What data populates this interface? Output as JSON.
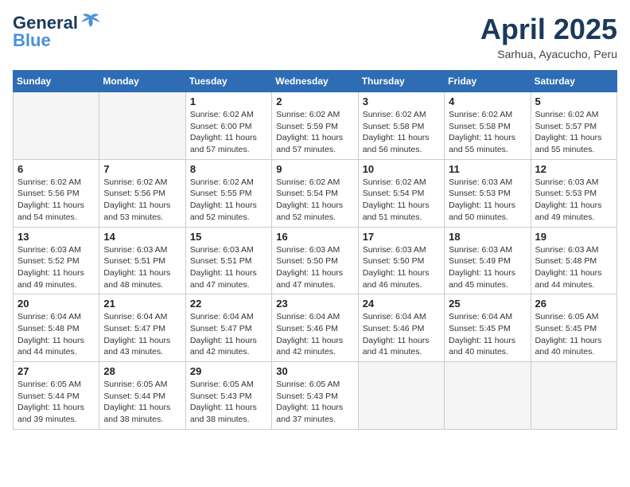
{
  "header": {
    "logo_general": "General",
    "logo_blue": "Blue",
    "month_title": "April 2025",
    "location": "Sarhua, Ayacucho, Peru"
  },
  "weekdays": [
    "Sunday",
    "Monday",
    "Tuesday",
    "Wednesday",
    "Thursday",
    "Friday",
    "Saturday"
  ],
  "weeks": [
    [
      {
        "day": "",
        "empty": true
      },
      {
        "day": "",
        "empty": true
      },
      {
        "day": "1",
        "sunrise": "6:02 AM",
        "sunset": "6:00 PM",
        "daylight": "11 hours and 57 minutes."
      },
      {
        "day": "2",
        "sunrise": "6:02 AM",
        "sunset": "5:59 PM",
        "daylight": "11 hours and 57 minutes."
      },
      {
        "day": "3",
        "sunrise": "6:02 AM",
        "sunset": "5:58 PM",
        "daylight": "11 hours and 56 minutes."
      },
      {
        "day": "4",
        "sunrise": "6:02 AM",
        "sunset": "5:58 PM",
        "daylight": "11 hours and 55 minutes."
      },
      {
        "day": "5",
        "sunrise": "6:02 AM",
        "sunset": "5:57 PM",
        "daylight": "11 hours and 55 minutes."
      }
    ],
    [
      {
        "day": "6",
        "sunrise": "6:02 AM",
        "sunset": "5:56 PM",
        "daylight": "11 hours and 54 minutes."
      },
      {
        "day": "7",
        "sunrise": "6:02 AM",
        "sunset": "5:56 PM",
        "daylight": "11 hours and 53 minutes."
      },
      {
        "day": "8",
        "sunrise": "6:02 AM",
        "sunset": "5:55 PM",
        "daylight": "11 hours and 52 minutes."
      },
      {
        "day": "9",
        "sunrise": "6:02 AM",
        "sunset": "5:54 PM",
        "daylight": "11 hours and 52 minutes."
      },
      {
        "day": "10",
        "sunrise": "6:02 AM",
        "sunset": "5:54 PM",
        "daylight": "11 hours and 51 minutes."
      },
      {
        "day": "11",
        "sunrise": "6:03 AM",
        "sunset": "5:53 PM",
        "daylight": "11 hours and 50 minutes."
      },
      {
        "day": "12",
        "sunrise": "6:03 AM",
        "sunset": "5:53 PM",
        "daylight": "11 hours and 49 minutes."
      }
    ],
    [
      {
        "day": "13",
        "sunrise": "6:03 AM",
        "sunset": "5:52 PM",
        "daylight": "11 hours and 49 minutes."
      },
      {
        "day": "14",
        "sunrise": "6:03 AM",
        "sunset": "5:51 PM",
        "daylight": "11 hours and 48 minutes."
      },
      {
        "day": "15",
        "sunrise": "6:03 AM",
        "sunset": "5:51 PM",
        "daylight": "11 hours and 47 minutes."
      },
      {
        "day": "16",
        "sunrise": "6:03 AM",
        "sunset": "5:50 PM",
        "daylight": "11 hours and 47 minutes."
      },
      {
        "day": "17",
        "sunrise": "6:03 AM",
        "sunset": "5:50 PM",
        "daylight": "11 hours and 46 minutes."
      },
      {
        "day": "18",
        "sunrise": "6:03 AM",
        "sunset": "5:49 PM",
        "daylight": "11 hours and 45 minutes."
      },
      {
        "day": "19",
        "sunrise": "6:03 AM",
        "sunset": "5:48 PM",
        "daylight": "11 hours and 44 minutes."
      }
    ],
    [
      {
        "day": "20",
        "sunrise": "6:04 AM",
        "sunset": "5:48 PM",
        "daylight": "11 hours and 44 minutes."
      },
      {
        "day": "21",
        "sunrise": "6:04 AM",
        "sunset": "5:47 PM",
        "daylight": "11 hours and 43 minutes."
      },
      {
        "day": "22",
        "sunrise": "6:04 AM",
        "sunset": "5:47 PM",
        "daylight": "11 hours and 42 minutes."
      },
      {
        "day": "23",
        "sunrise": "6:04 AM",
        "sunset": "5:46 PM",
        "daylight": "11 hours and 42 minutes."
      },
      {
        "day": "24",
        "sunrise": "6:04 AM",
        "sunset": "5:46 PM",
        "daylight": "11 hours and 41 minutes."
      },
      {
        "day": "25",
        "sunrise": "6:04 AM",
        "sunset": "5:45 PM",
        "daylight": "11 hours and 40 minutes."
      },
      {
        "day": "26",
        "sunrise": "6:05 AM",
        "sunset": "5:45 PM",
        "daylight": "11 hours and 40 minutes."
      }
    ],
    [
      {
        "day": "27",
        "sunrise": "6:05 AM",
        "sunset": "5:44 PM",
        "daylight": "11 hours and 39 minutes."
      },
      {
        "day": "28",
        "sunrise": "6:05 AM",
        "sunset": "5:44 PM",
        "daylight": "11 hours and 38 minutes."
      },
      {
        "day": "29",
        "sunrise": "6:05 AM",
        "sunset": "5:43 PM",
        "daylight": "11 hours and 38 minutes."
      },
      {
        "day": "30",
        "sunrise": "6:05 AM",
        "sunset": "5:43 PM",
        "daylight": "11 hours and 37 minutes."
      },
      {
        "day": "",
        "empty": true
      },
      {
        "day": "",
        "empty": true
      },
      {
        "day": "",
        "empty": true
      }
    ]
  ]
}
